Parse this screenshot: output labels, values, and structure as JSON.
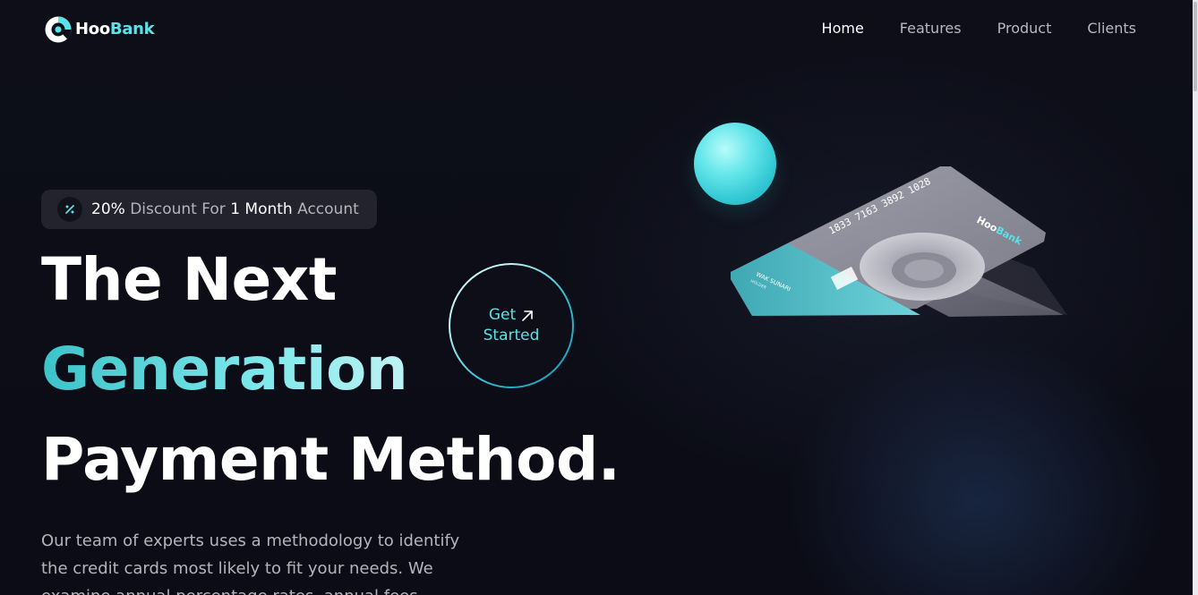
{
  "brand": {
    "name_part1": "Hoo",
    "name_part2": "Bank",
    "accent_color": "#5ce1e6"
  },
  "nav": {
    "items": [
      {
        "label": "Home",
        "active": true
      },
      {
        "label": "Features",
        "active": false
      },
      {
        "label": "Product",
        "active": false
      },
      {
        "label": "Clients",
        "active": false
      }
    ]
  },
  "badge": {
    "icon": "discount-icon",
    "percent": "20%",
    "text1": " Discount For ",
    "month": "1 Month",
    "text2": " Account"
  },
  "hero": {
    "line1": "The Next",
    "line2": "Generation",
    "line3": "Payment Method.",
    "paragraph": "Our team of experts uses a methodology to identify the credit cards most likely to fit your needs. We examine annual percentage rates, annual fees."
  },
  "cta": {
    "line1": "Get",
    "line2": "Started",
    "icon": "arrow-up-right-icon"
  },
  "card": {
    "number": "1833 7163 3892 1028",
    "holder": "WAK SUNARI",
    "holder_sub": "HOLDER",
    "brand_part1": "Hoo",
    "brand_part2": "Bank"
  }
}
